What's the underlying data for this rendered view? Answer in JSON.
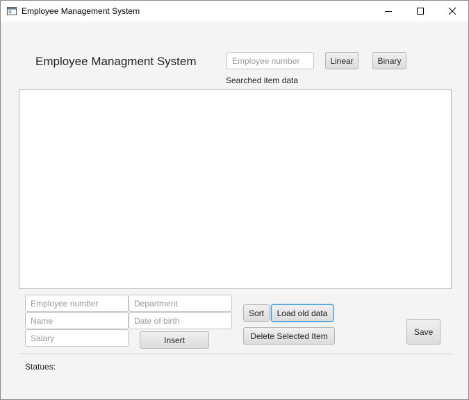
{
  "window": {
    "title": "Employee Management System",
    "controls": {
      "minimize": "minimize",
      "maximize": "maximize",
      "close": "close"
    }
  },
  "header": {
    "heading": "Employee Managment System",
    "search_placeholder": "Employee number",
    "linear_label": "Linear",
    "binary_label": "Binary",
    "searched_label": "Searched item data"
  },
  "form": {
    "employee_number_placeholder": "Employee number",
    "department_placeholder": "Department",
    "name_placeholder": "Name",
    "dob_placeholder": "Date of birth",
    "salary_placeholder": "Salary",
    "insert_label": "Insert"
  },
  "actions": {
    "sort_label": "Sort",
    "load_label": "Load old data",
    "delete_label": "Delete Selected Item",
    "save_label": "Save"
  },
  "status": {
    "label": "Statues:"
  },
  "icons": {
    "app": "app-window-icon",
    "minimize": "minimize-icon",
    "maximize": "maximize-icon",
    "close": "close-icon"
  }
}
